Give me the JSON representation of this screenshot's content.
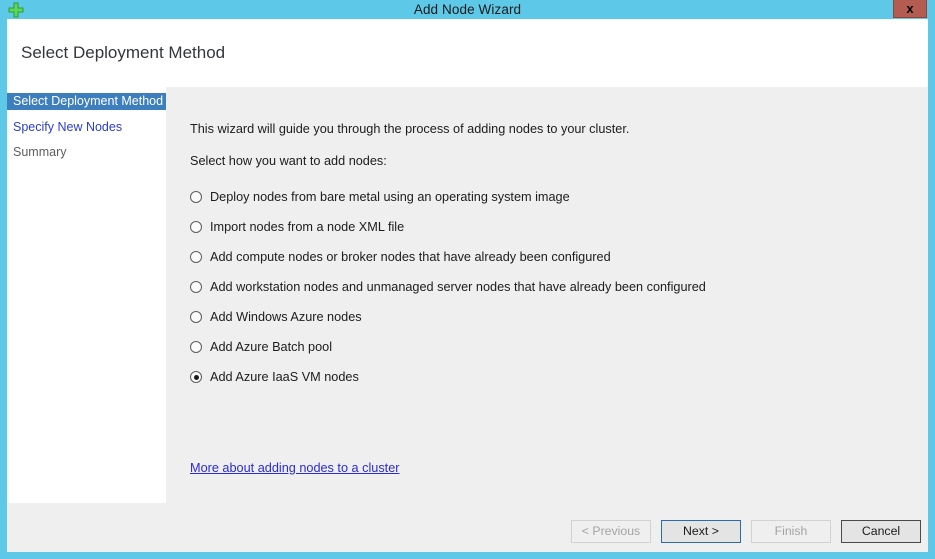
{
  "window": {
    "title": "Add Node Wizard",
    "app_icon": "green-plus-icon",
    "close_label": "x",
    "frame_color": "#5ec8e8"
  },
  "header": {
    "page_title": "Select Deployment Method"
  },
  "sidebar": {
    "items": [
      {
        "label": "Select Deployment Method",
        "state": "selected"
      },
      {
        "label": "Specify New Nodes",
        "state": "link"
      },
      {
        "label": "Summary",
        "state": "muted"
      }
    ]
  },
  "content": {
    "intro_text": "This wizard will guide you through the process of adding nodes to your cluster.",
    "prompt_text": "Select how you want to add nodes:",
    "options": [
      {
        "label": "Deploy nodes from bare metal using an operating system image",
        "checked": false
      },
      {
        "label": "Import nodes from a node XML file",
        "checked": false
      },
      {
        "label": "Add compute nodes or broker nodes that have already been configured",
        "checked": false
      },
      {
        "label": "Add workstation nodes and unmanaged server nodes that have already been configured",
        "checked": false
      },
      {
        "label": "Add Windows Azure nodes",
        "checked": false
      },
      {
        "label": "Add Azure Batch pool",
        "checked": false
      },
      {
        "label": "Add Azure IaaS VM nodes",
        "checked": true
      }
    ],
    "help_link": "More about adding nodes to a cluster"
  },
  "footer": {
    "buttons": [
      {
        "label": "< Previous",
        "style": "disabled"
      },
      {
        "label": "Next >",
        "style": "default"
      },
      {
        "label": "Finish",
        "style": "disabled"
      },
      {
        "label": "Cancel",
        "style": "strong"
      }
    ]
  },
  "colors": {
    "titlebar": "#5ec8e8",
    "selected_nav": "#3d7fbd",
    "link": "#2b2bd6",
    "content_bg": "#efefef",
    "close_button": "#b55c52"
  }
}
